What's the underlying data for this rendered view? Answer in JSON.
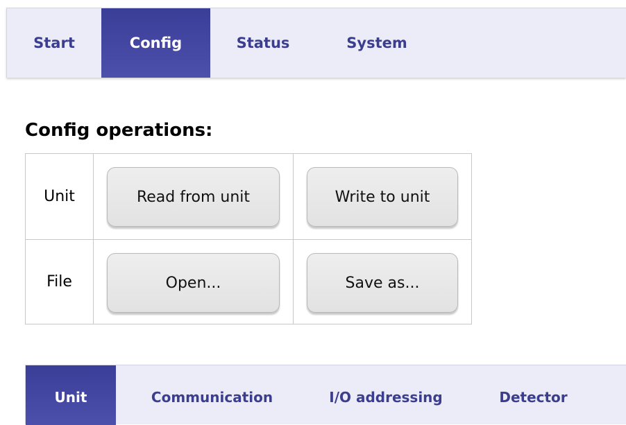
{
  "top_nav": {
    "tabs": [
      {
        "label": "Start",
        "active": false
      },
      {
        "label": "Config",
        "active": true
      },
      {
        "label": "Status",
        "active": false
      },
      {
        "label": "System",
        "active": false
      }
    ]
  },
  "config_operations": {
    "heading": "Config operations:",
    "rows": [
      {
        "label": "Unit",
        "buttons": [
          "Read from unit",
          "Write to unit"
        ]
      },
      {
        "label": "File",
        "buttons": [
          "Open...",
          "Save as..."
        ]
      }
    ]
  },
  "sub_nav": {
    "tabs": [
      {
        "label": "Unit",
        "active": true
      },
      {
        "label": "Communication",
        "active": false
      },
      {
        "label": "I/O addressing",
        "active": false
      },
      {
        "label": "Detector",
        "active": false
      }
    ]
  },
  "colors": {
    "nav_background": "#ecebf8",
    "tab_active": "#4044a0",
    "tab_text": "#3b3e8e",
    "button_face": "#e6e6e6",
    "table_border": "#c8c8c8"
  }
}
